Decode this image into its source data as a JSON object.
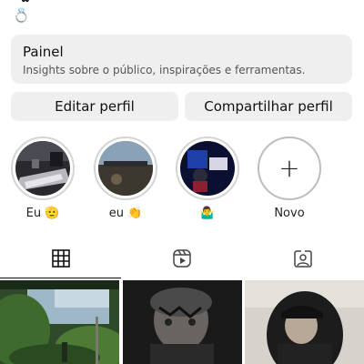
{
  "profile": {
    "ring_emoji": "💍",
    "cut_text": "✿"
  },
  "panel": {
    "title": "Painel",
    "subtitle": "Insights sobre o público, inspirações e ferramentas."
  },
  "buttons": {
    "edit": "Editar perfil",
    "share": "Compartilhar perfil"
  },
  "stories": [
    {
      "label": "Eu 🫡"
    },
    {
      "label": "eu 👏"
    },
    {
      "label": "🤷‍♂️"
    },
    {
      "label": "Novo",
      "plus": "+"
    }
  ],
  "tabs": [
    "grid-icon",
    "reels-icon",
    "tagged-icon"
  ]
}
